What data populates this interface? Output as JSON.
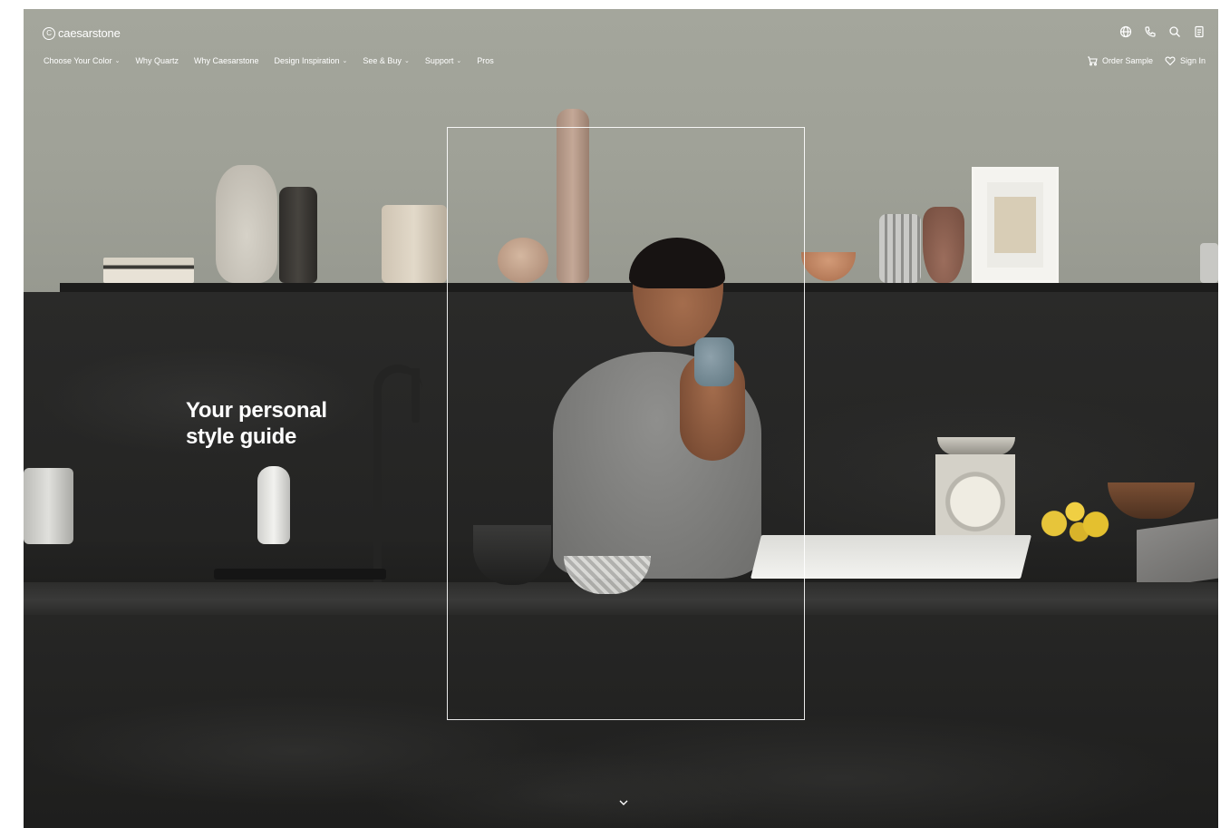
{
  "brand": {
    "logo_text": "caesarstone"
  },
  "nav": {
    "items": [
      {
        "label": "Choose Your Color",
        "has_dropdown": true
      },
      {
        "label": "Why Quartz",
        "has_dropdown": false
      },
      {
        "label": "Why Caesarstone",
        "has_dropdown": false
      },
      {
        "label": "Design Inspiration",
        "has_dropdown": true
      },
      {
        "label": "See & Buy",
        "has_dropdown": true
      },
      {
        "label": "Support",
        "has_dropdown": true
      },
      {
        "label": "Pros",
        "has_dropdown": false
      }
    ],
    "chevron": "⌄"
  },
  "utility": {
    "icons": [
      "globe-icon",
      "phone-icon",
      "search-icon",
      "document-icon"
    ]
  },
  "account": {
    "order_sample_label": "Order Sample",
    "sign_in_label": "Sign In"
  },
  "hero": {
    "title_line1": "Your personal",
    "title_line2": "style guide"
  },
  "colors": {
    "text_on_image": "#ffffff",
    "countertop": "#262625",
    "wall": "#9fa197"
  }
}
